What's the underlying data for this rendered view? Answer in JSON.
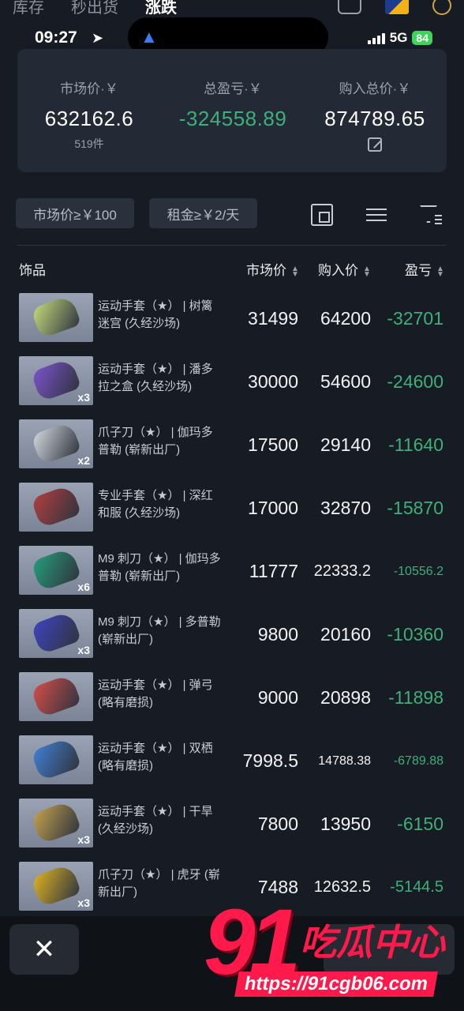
{
  "top_tabs": [
    "库存",
    "秒出货",
    "涨跌"
  ],
  "status_bar": {
    "time": "09:27",
    "network": "5G",
    "battery": "84"
  },
  "summary": {
    "market": {
      "label": "市场价·￥",
      "value": "632162.6",
      "sub": "519件"
    },
    "pnl": {
      "label": "总盈亏·￥",
      "value": "-324558.89"
    },
    "cost": {
      "label": "购入总价·￥",
      "value": "874789.65"
    }
  },
  "filters": {
    "chip1": "市场价≥￥100",
    "chip2": "租金≥￥2/天"
  },
  "icons": [
    "grid-view-icon",
    "list-view-icon",
    "filter-icon"
  ],
  "table": {
    "headers": {
      "item": "饰品",
      "market": "市场价",
      "buy": "购入价",
      "pnl": "盈亏"
    },
    "rows": [
      {
        "name": "运动手套（★） | 树篱迷宫 (久经沙场)",
        "qty": "",
        "market": "31499",
        "buy": "64200",
        "pnl": "-32701",
        "color": "#c9e07a"
      },
      {
        "name": "运动手套（★） | 潘多拉之盒 (久经沙场)",
        "qty": "x3",
        "market": "30000",
        "buy": "54600",
        "pnl": "-24600",
        "color": "#7b4fcf"
      },
      {
        "name": "爪子刀（★） | 伽玛多普勒 (崭新出厂)",
        "qty": "x2",
        "market": "17500",
        "buy": "29140",
        "pnl": "-11640",
        "color": "#d9dde3"
      },
      {
        "name": "专业手套（★） | 深红和服 (久经沙场)",
        "qty": "",
        "market": "17000",
        "buy": "32870",
        "pnl": "-15870",
        "color": "#b33a3a"
      },
      {
        "name": "M9 刺刀（★） | 伽玛多普勒 (崭新出厂)",
        "qty": "x6",
        "market": "11777",
        "buy": "22333.2",
        "pnl": "-10556.2",
        "color": "#1f9e7a"
      },
      {
        "name": "M9 刺刀（★） | 多普勒 (崭新出厂)",
        "qty": "x3",
        "market": "9800",
        "buy": "20160",
        "pnl": "-10360",
        "color": "#3a3fc2"
      },
      {
        "name": "运动手套（★） | 弹弓 (略有磨损)",
        "qty": "",
        "market": "9000",
        "buy": "20898",
        "pnl": "-11898",
        "color": "#d94a44"
      },
      {
        "name": "运动手套（★） | 双栖 (略有磨损)",
        "qty": "",
        "market": "7998.5",
        "buy": "14788.38",
        "pnl": "-6789.88",
        "color": "#3c7fd6"
      },
      {
        "name": "运动手套（★） | 干旱 (久经沙场)",
        "qty": "x3",
        "market": "7800",
        "buy": "13950",
        "pnl": "-6150",
        "color": "#c8a24a"
      },
      {
        "name": "爪子刀（★） | 虎牙 (崭新出厂)",
        "qty": "x3",
        "market": "7488",
        "buy": "12632.5",
        "pnl": "-5144.5",
        "color": "#e3b51c"
      }
    ]
  },
  "bottom": {
    "close": "✕"
  },
  "watermark": {
    "number": "91",
    "text": "吃瓜中心",
    "url": "https://91cgb06.com"
  }
}
